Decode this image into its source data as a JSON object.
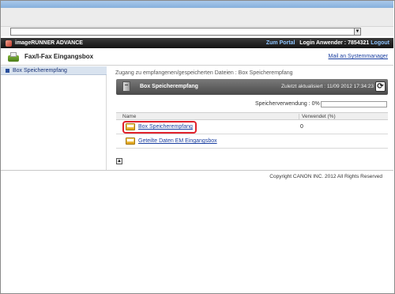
{
  "header": {
    "brand": "imageRUNNER ADVANCE",
    "portal_link": "Zum Portal",
    "login_prefix": "Login Anwender :",
    "user": "7854321",
    "logout_link": "Logout"
  },
  "subheader": {
    "title": "Fax/I-Fax Eingangsbox",
    "mail_link": "Mail an Systemmanager"
  },
  "sidebar": {
    "items": [
      {
        "label": "Box Speicherempfang"
      }
    ]
  },
  "main": {
    "breadcrumb": "Zugang zu empfangenen/gespeicherten Dateien : Box Speicherempfang",
    "panel_title": "Box Speicherempfang",
    "last_updated": "Zuletzt aktualisiert : 11/09 2012 17:34:23",
    "usage_label": "Speicherverwendung : 0%",
    "usage_percent": 0,
    "table": {
      "col_name": "Name",
      "col_used": "Verwendet (%)",
      "rows": [
        {
          "name": "Box Speicherempfang",
          "used": "0",
          "highlighted": true
        },
        {
          "name": "Geteilte Daten EM Eingangsbox",
          "used": ""
        }
      ]
    }
  },
  "footer": {
    "copyright": "Copyright CANON INC. 2012 All Rights Reserved"
  },
  "icons": {
    "dropdown": "▼",
    "refresh": "⟳",
    "to_top": "▲"
  },
  "colors": {
    "highlight_border": "#e0212b",
    "link": "#1a3fa0",
    "header_bg": "#1c1c1c"
  }
}
